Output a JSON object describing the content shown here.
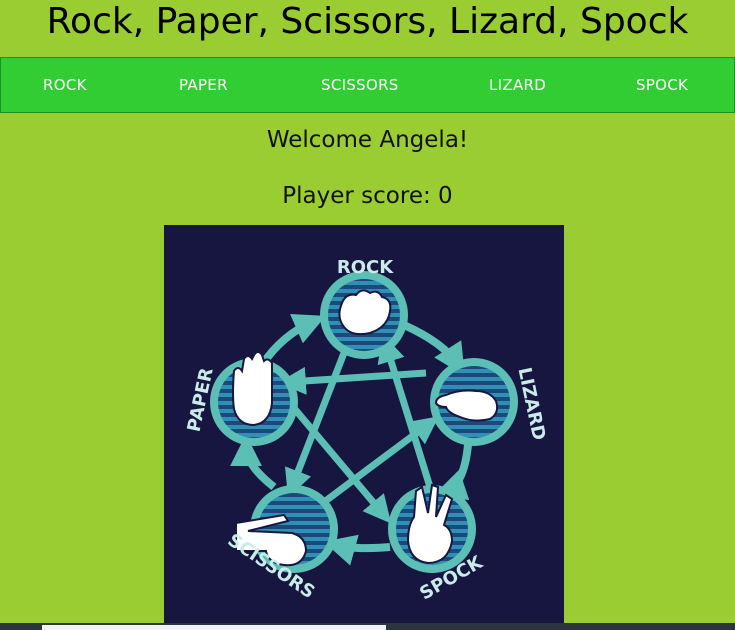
{
  "header": {
    "title": "Rock, Paper, Scissors, Lizard, Spock"
  },
  "nav": {
    "buttons": [
      {
        "label": "ROCK"
      },
      {
        "label": "PAPER"
      },
      {
        "label": "SCISSORS"
      },
      {
        "label": "LIZARD"
      },
      {
        "label": "SPOCK"
      }
    ]
  },
  "main": {
    "welcome": "Welcome Angela!",
    "score_text": "Player score: 0"
  },
  "diagram": {
    "labels": {
      "rock": "ROCK",
      "paper": "PAPER",
      "scissors": "SCISSORS",
      "lizard": "LIZARD",
      "spock": "SPOCK"
    }
  },
  "colors": {
    "background": "#9acd32",
    "nav": "#32cd32",
    "diagram_bg": "#171640",
    "accent": "#5bbfb5"
  }
}
